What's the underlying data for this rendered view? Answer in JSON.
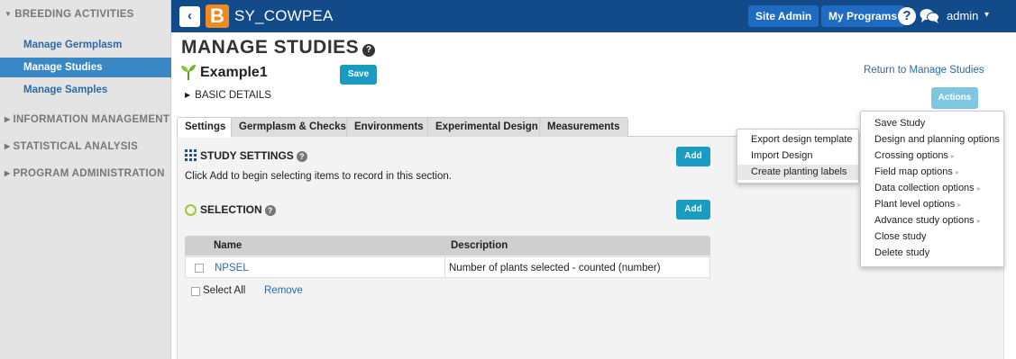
{
  "sidebar": {
    "sections": [
      {
        "label": "BREEDING ACTIVITIES",
        "expanded": true
      },
      {
        "label": "INFORMATION MANAGEMENT",
        "expanded": false
      },
      {
        "label": "STATISTICAL ANALYSIS",
        "expanded": false
      },
      {
        "label": "PROGRAM ADMINISTRATION",
        "expanded": false
      }
    ],
    "items": [
      {
        "label": "Manage Germplasm",
        "active": false
      },
      {
        "label": "Manage Studies",
        "active": true
      },
      {
        "label": "Manage Samples",
        "active": false
      }
    ]
  },
  "topbar": {
    "back_icon": "‹",
    "logo_letter": "B",
    "app_name": "SY_COWPEA",
    "site_admin_label": "Site Admin",
    "my_programs_label": "My Programs",
    "help_glyph": "?",
    "user_label": "admin",
    "caret": "▾"
  },
  "page": {
    "title": "MANAGE STUDIES",
    "help_glyph": "?",
    "study_name": "Example1",
    "save_label": "Save",
    "basic_details_label": "BASIC DETAILS",
    "return_link": "Return to Manage Studies",
    "actions_label": "Actions"
  },
  "tabs": [
    {
      "label": "Settings",
      "active": true
    },
    {
      "label": "Germplasm & Checks",
      "active": false
    },
    {
      "label": "Environments",
      "active": false
    },
    {
      "label": "Experimental Design",
      "active": false
    },
    {
      "label": "Measurements",
      "active": false
    }
  ],
  "study_settings": {
    "heading": "STUDY SETTINGS",
    "help_glyph": "?",
    "add_label": "Add",
    "hint": "Click Add to begin selecting items to record in this section."
  },
  "selection": {
    "heading": "SELECTION",
    "help_glyph": "?",
    "add_label": "Add",
    "columns": [
      "Name",
      "Description"
    ],
    "rows": [
      {
        "name": "NPSEL",
        "description": "Number of plants selected - counted (number)"
      }
    ],
    "select_all_label": "Select All",
    "remove_label": "Remove"
  },
  "design_menu": {
    "items": [
      "Export design template",
      "Import Design",
      "Create planting labels"
    ],
    "highlighted_index": 2
  },
  "actions_menu": {
    "items": [
      {
        "label": "Save Study",
        "submenu": false
      },
      {
        "label": "Design and planning options",
        "submenu": false
      },
      {
        "label": "Crossing options",
        "submenu": true
      },
      {
        "label": "Field map options",
        "submenu": true
      },
      {
        "label": "Data collection options",
        "submenu": true
      },
      {
        "label": "Plant level options",
        "submenu": true
      },
      {
        "label": "Advance study options",
        "submenu": true
      },
      {
        "label": "Close study",
        "submenu": false
      },
      {
        "label": "Delete study",
        "submenu": false
      }
    ],
    "submenu_arrow": "▸"
  },
  "colors": {
    "topbar": "#124a8a",
    "sidebar_active": "#3a87c6",
    "link": "#2a6aa8",
    "primary_button": "#1a9bc2",
    "logo": "#f08a1c"
  }
}
